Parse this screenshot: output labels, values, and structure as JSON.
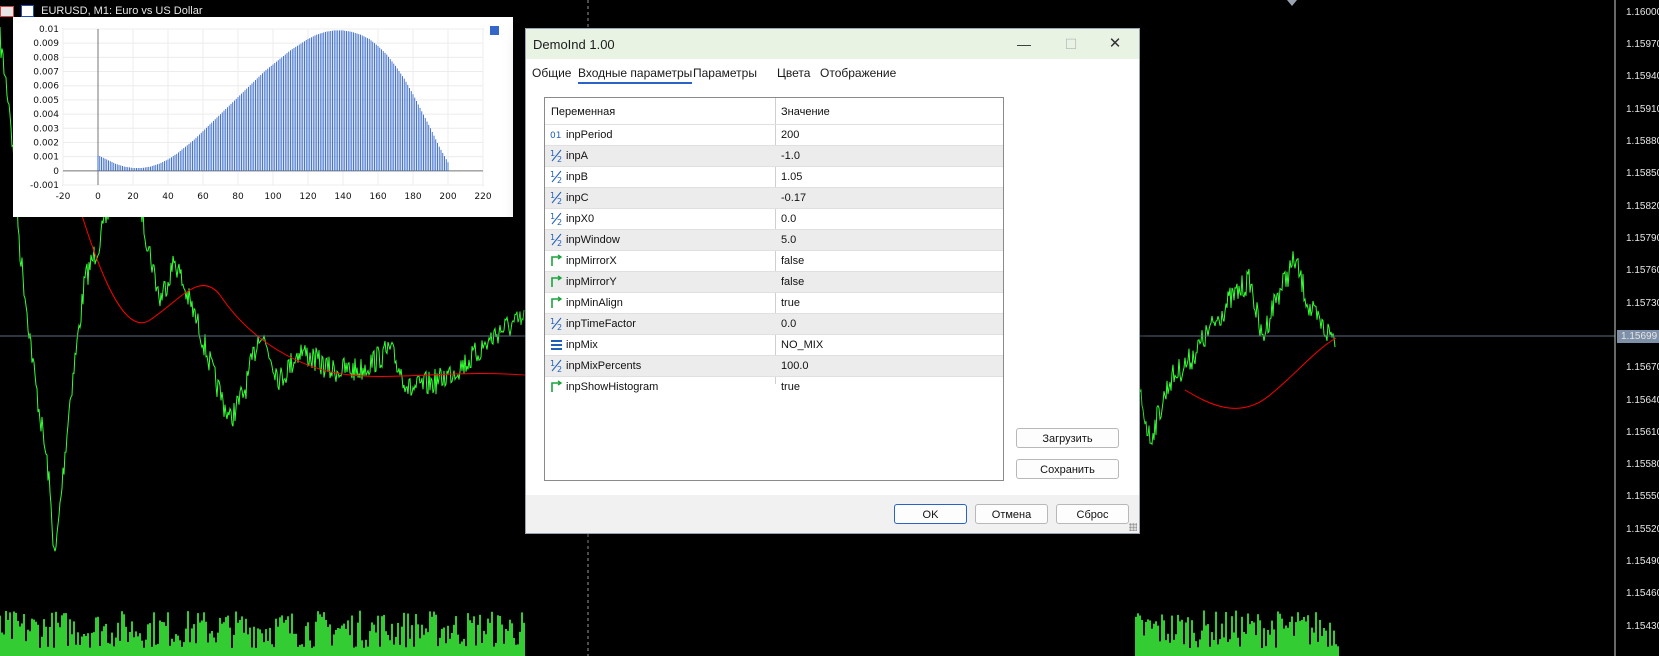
{
  "window": {
    "title": "EURUSD, M1:  Euro vs US Dollar"
  },
  "price_axis": {
    "labels": [
      "1.16000",
      "1.15970",
      "1.15940",
      "1.15910",
      "1.15880",
      "1.15850",
      "1.15820",
      "1.15790",
      "1.15760",
      "1.15730",
      "1.15670",
      "1.15640",
      "1.15610",
      "1.15580",
      "1.15550",
      "1.15520",
      "1.15490",
      "1.15460",
      "1.15430"
    ],
    "current_price": "1.15699",
    "current_price_color": "#7e8fa8"
  },
  "colors": {
    "price_line": "#33ff33",
    "ma_line": "#ff0000",
    "volume": "#33cc33",
    "histogram_bars": "#3567c8",
    "dialog_titlebar": "#e9f3e4",
    "accent": "#2a62c7"
  },
  "chart_data": {
    "type": "bar",
    "title": "",
    "xlabel": "",
    "ylabel": "",
    "xlim": [
      -20,
      220
    ],
    "ylim": [
      -0.001,
      0.01
    ],
    "x_ticks": [
      "-20",
      "0",
      "20",
      "40",
      "60",
      "80",
      "100",
      "120",
      "140",
      "160",
      "180",
      "200",
      "220"
    ],
    "y_ticks": [
      "0.01",
      "0.009",
      "0.008",
      "0.007",
      "0.006",
      "0.005",
      "0.004",
      "0.003",
      "0.002",
      "0.001",
      "0",
      "-0.001"
    ],
    "series": [
      {
        "color": "#3567c8",
        "x": [
          0,
          5,
          10,
          15,
          20,
          25,
          30,
          35,
          40,
          45,
          50,
          55,
          60,
          65,
          70,
          75,
          80,
          85,
          90,
          95,
          100,
          105,
          110,
          115,
          120,
          125,
          130,
          135,
          140,
          145,
          150,
          155,
          160,
          165,
          170,
          175,
          180,
          185,
          190,
          195,
          200
        ],
        "values": [
          0.0011,
          0.0008,
          0.0005,
          0.0003,
          0.0002,
          0.0002,
          0.0003,
          0.0005,
          0.0008,
          0.0012,
          0.0017,
          0.0022,
          0.0028,
          0.0034,
          0.004,
          0.0046,
          0.0052,
          0.0058,
          0.0064,
          0.007,
          0.0075,
          0.008,
          0.0085,
          0.0089,
          0.0093,
          0.0096,
          0.0098,
          0.0099,
          0.0099,
          0.0098,
          0.0096,
          0.0093,
          0.0088,
          0.0082,
          0.0074,
          0.0065,
          0.0054,
          0.0042,
          0.003,
          0.0017,
          0.0006
        ]
      }
    ],
    "grid": true
  },
  "dialog": {
    "title": "DemoInd 1.00",
    "minimize": "—",
    "maximize": "☐",
    "close": "✕",
    "tabs": [
      "Общие",
      "Входные параметры",
      "Параметры",
      "Цвета",
      "Отображение"
    ],
    "active_tab": "Входные параметры",
    "columns": {
      "variable": "Переменная",
      "value": "Значение"
    },
    "params": [
      {
        "icon": "integer-icon",
        "name": "inpPeriod",
        "value": "200"
      },
      {
        "icon": "fraction-icon",
        "name": "inpA",
        "value": "-1.0"
      },
      {
        "icon": "fraction-icon",
        "name": "inpB",
        "value": "1.05"
      },
      {
        "icon": "fraction-icon",
        "name": "inpC",
        "value": "-0.17"
      },
      {
        "icon": "fraction-icon",
        "name": "inpX0",
        "value": "0.0"
      },
      {
        "icon": "fraction-icon",
        "name": "inpWindow",
        "value": "5.0"
      },
      {
        "icon": "bool-icon",
        "name": "inpMirrorX",
        "value": "false"
      },
      {
        "icon": "bool-icon",
        "name": "inpMirrorY",
        "value": "false"
      },
      {
        "icon": "bool-icon",
        "name": "inpMinAlign",
        "value": "true"
      },
      {
        "icon": "fraction-icon",
        "name": "inpTimeFactor",
        "value": "0.0"
      },
      {
        "icon": "enum-icon",
        "name": "inpMix",
        "value": "NO_MIX"
      },
      {
        "icon": "fraction-icon",
        "name": "inpMixPercents",
        "value": "100.0"
      },
      {
        "icon": "bool-icon",
        "name": "inpShowHistogram",
        "value": "true"
      }
    ],
    "side_buttons": {
      "load": "Загрузить",
      "save": "Сохранить"
    },
    "footer_buttons": {
      "ok": "OK",
      "cancel": "Отмена",
      "reset": "Сброс"
    }
  }
}
